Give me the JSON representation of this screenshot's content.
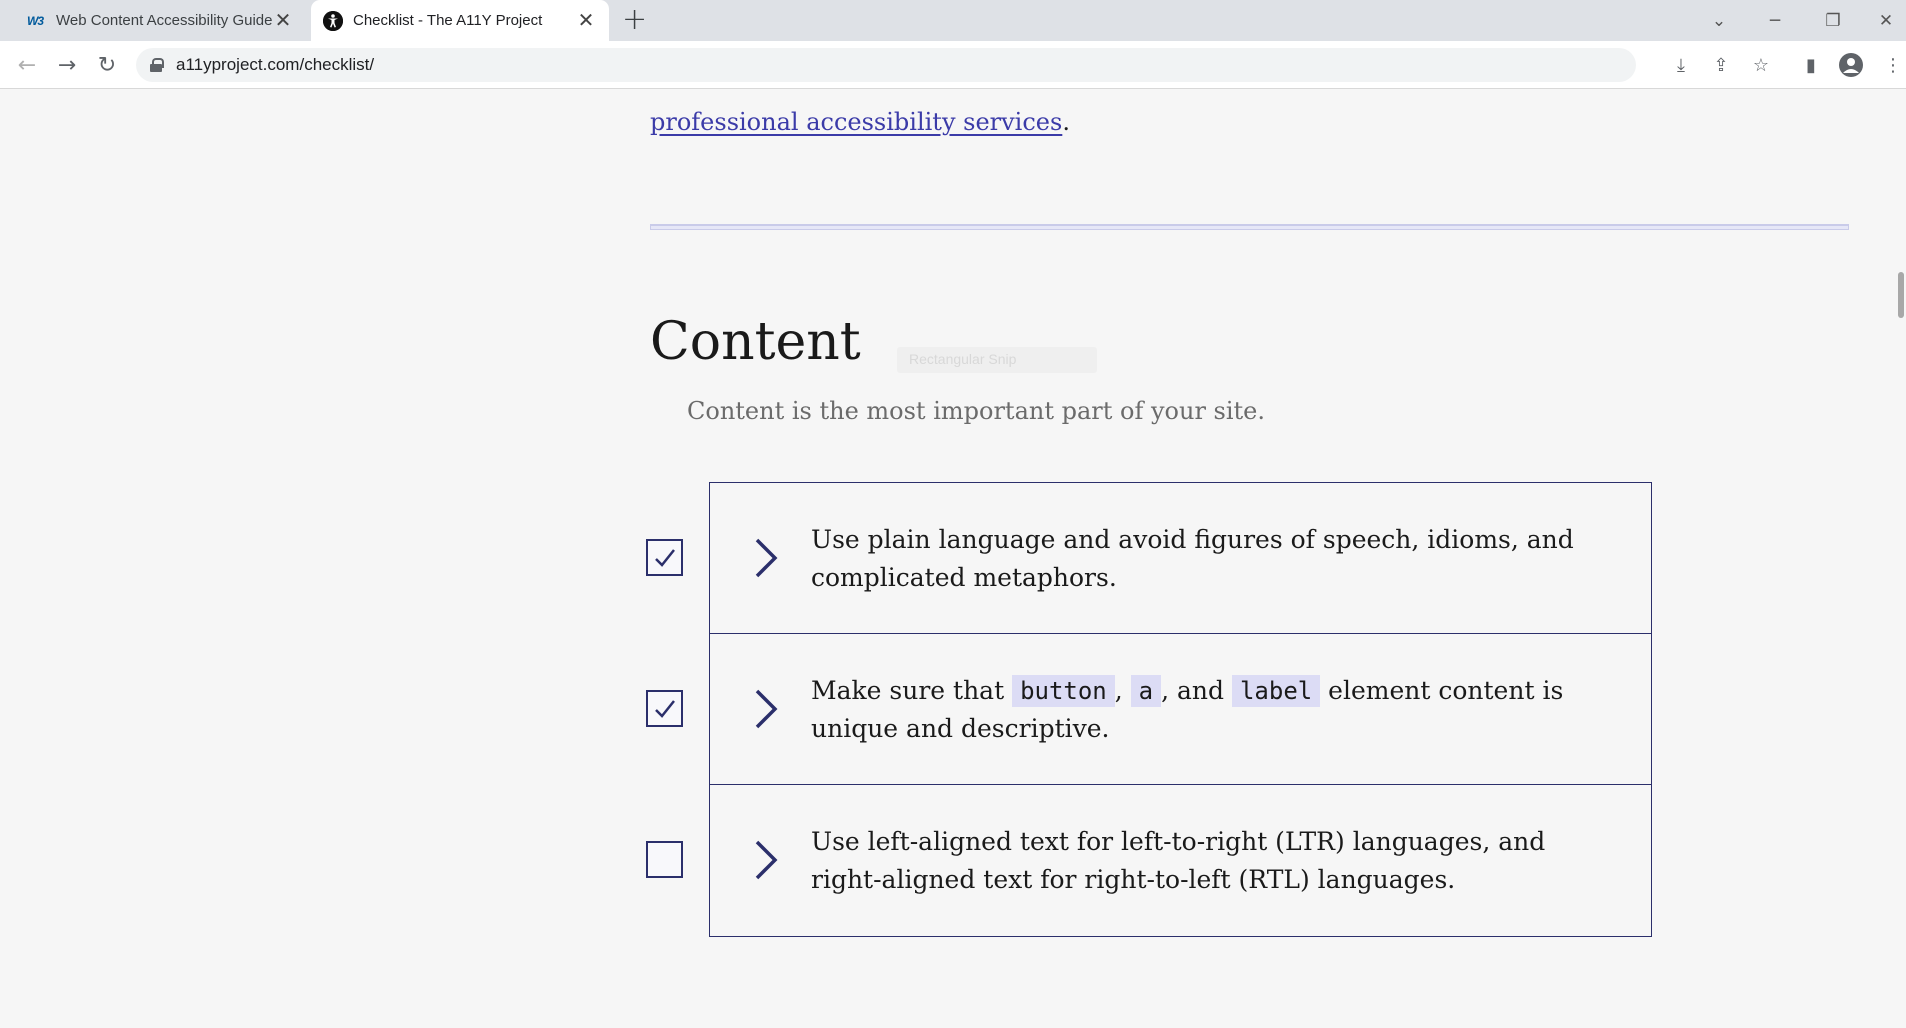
{
  "browser": {
    "tabs": [
      {
        "title": "Web Content Accessibility Guidel",
        "favicon": "w3c-icon",
        "active": false
      },
      {
        "title": "Checklist - The A11Y Project",
        "favicon": "a11y-icon",
        "active": true
      }
    ],
    "url": "a11yproject.com/checklist/"
  },
  "page": {
    "intro_link_text": "professional accessibility services",
    "intro_link_trailing": ".",
    "section_title": "Content",
    "section_description": "Content is the most important part of your site.",
    "ghost_chip_text": "Rectangular Snip",
    "checklist": [
      {
        "checked": true,
        "text": "Use plain language and avoid figures of speech, idioms, and complicated metaphors."
      },
      {
        "checked": true,
        "parts": [
          "Make sure that ",
          "button",
          ", ",
          "a",
          ", and ",
          "label",
          " element content is unique and descriptive."
        ]
      },
      {
        "checked": false,
        "text": "Use left-aligned text for left-to-right (LTR) languages, and right-aligned text for right-to-left (RTL) languages."
      }
    ]
  },
  "colors": {
    "accent": "#2b2f6b",
    "link": "#3b3ba8",
    "code_bg": "#dcdcf5",
    "page_bg": "#f6f6f6"
  }
}
